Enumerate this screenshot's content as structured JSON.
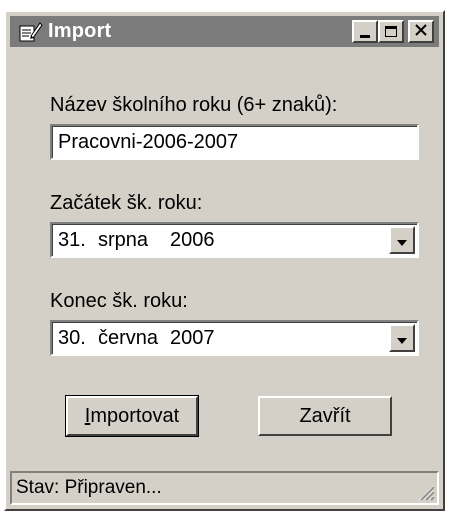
{
  "window": {
    "title": "Import",
    "icon": "import-pencil-icon",
    "controls": [
      "minimize-icon",
      "maximize-icon",
      "close-icon"
    ]
  },
  "form": {
    "name_label": "Název školního roku (6+ znaků):",
    "name_value": "Pracovni-2006-2007",
    "start_label": "Začátek šk. roku:",
    "start_day": "31.",
    "start_month": "srpna",
    "start_year": "2006",
    "end_label": "Konec šk. roku:",
    "end_day": "30.",
    "end_month": "června",
    "end_year": "2007"
  },
  "buttons": {
    "import_label_accel": "I",
    "import_label_rest": "mportovat",
    "close_label": "Zavřít"
  },
  "status": {
    "text": "Stav: Připraven..."
  },
  "colors": {
    "face": "#d4d0c8",
    "titlebar_inactive": "#7b7b7b",
    "field_bg": "#ffffff"
  }
}
